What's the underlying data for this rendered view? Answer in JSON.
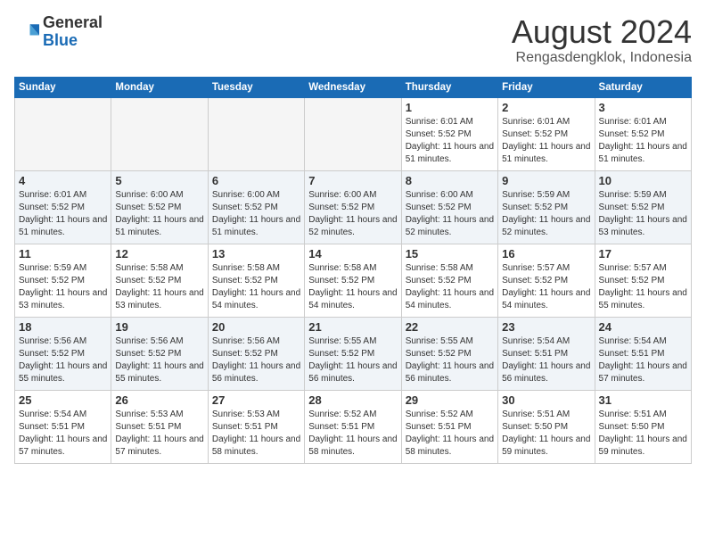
{
  "header": {
    "logo_general": "General",
    "logo_blue": "Blue",
    "month_year": "August 2024",
    "location": "Rengasdengklok, Indonesia"
  },
  "calendar": {
    "days_of_week": [
      "Sunday",
      "Monday",
      "Tuesday",
      "Wednesday",
      "Thursday",
      "Friday",
      "Saturday"
    ],
    "weeks": [
      [
        {
          "day": "",
          "empty": true
        },
        {
          "day": "",
          "empty": true
        },
        {
          "day": "",
          "empty": true
        },
        {
          "day": "",
          "empty": true
        },
        {
          "day": "1",
          "sunrise": "6:01 AM",
          "sunset": "5:52 PM",
          "daylight": "11 hours and 51 minutes."
        },
        {
          "day": "2",
          "sunrise": "6:01 AM",
          "sunset": "5:52 PM",
          "daylight": "11 hours and 51 minutes."
        },
        {
          "day": "3",
          "sunrise": "6:01 AM",
          "sunset": "5:52 PM",
          "daylight": "11 hours and 51 minutes."
        }
      ],
      [
        {
          "day": "4",
          "sunrise": "6:01 AM",
          "sunset": "5:52 PM",
          "daylight": "11 hours and 51 minutes."
        },
        {
          "day": "5",
          "sunrise": "6:00 AM",
          "sunset": "5:52 PM",
          "daylight": "11 hours and 51 minutes."
        },
        {
          "day": "6",
          "sunrise": "6:00 AM",
          "sunset": "5:52 PM",
          "daylight": "11 hours and 51 minutes."
        },
        {
          "day": "7",
          "sunrise": "6:00 AM",
          "sunset": "5:52 PM",
          "daylight": "11 hours and 52 minutes."
        },
        {
          "day": "8",
          "sunrise": "6:00 AM",
          "sunset": "5:52 PM",
          "daylight": "11 hours and 52 minutes."
        },
        {
          "day": "9",
          "sunrise": "5:59 AM",
          "sunset": "5:52 PM",
          "daylight": "11 hours and 52 minutes."
        },
        {
          "day": "10",
          "sunrise": "5:59 AM",
          "sunset": "5:52 PM",
          "daylight": "11 hours and 53 minutes."
        }
      ],
      [
        {
          "day": "11",
          "sunrise": "5:59 AM",
          "sunset": "5:52 PM",
          "daylight": "11 hours and 53 minutes."
        },
        {
          "day": "12",
          "sunrise": "5:58 AM",
          "sunset": "5:52 PM",
          "daylight": "11 hours and 53 minutes."
        },
        {
          "day": "13",
          "sunrise": "5:58 AM",
          "sunset": "5:52 PM",
          "daylight": "11 hours and 54 minutes."
        },
        {
          "day": "14",
          "sunrise": "5:58 AM",
          "sunset": "5:52 PM",
          "daylight": "11 hours and 54 minutes."
        },
        {
          "day": "15",
          "sunrise": "5:58 AM",
          "sunset": "5:52 PM",
          "daylight": "11 hours and 54 minutes."
        },
        {
          "day": "16",
          "sunrise": "5:57 AM",
          "sunset": "5:52 PM",
          "daylight": "11 hours and 54 minutes."
        },
        {
          "day": "17",
          "sunrise": "5:57 AM",
          "sunset": "5:52 PM",
          "daylight": "11 hours and 55 minutes."
        }
      ],
      [
        {
          "day": "18",
          "sunrise": "5:56 AM",
          "sunset": "5:52 PM",
          "daylight": "11 hours and 55 minutes."
        },
        {
          "day": "19",
          "sunrise": "5:56 AM",
          "sunset": "5:52 PM",
          "daylight": "11 hours and 55 minutes."
        },
        {
          "day": "20",
          "sunrise": "5:56 AM",
          "sunset": "5:52 PM",
          "daylight": "11 hours and 56 minutes."
        },
        {
          "day": "21",
          "sunrise": "5:55 AM",
          "sunset": "5:52 PM",
          "daylight": "11 hours and 56 minutes."
        },
        {
          "day": "22",
          "sunrise": "5:55 AM",
          "sunset": "5:52 PM",
          "daylight": "11 hours and 56 minutes."
        },
        {
          "day": "23",
          "sunrise": "5:54 AM",
          "sunset": "5:51 PM",
          "daylight": "11 hours and 56 minutes."
        },
        {
          "day": "24",
          "sunrise": "5:54 AM",
          "sunset": "5:51 PM",
          "daylight": "11 hours and 57 minutes."
        }
      ],
      [
        {
          "day": "25",
          "sunrise": "5:54 AM",
          "sunset": "5:51 PM",
          "daylight": "11 hours and 57 minutes."
        },
        {
          "day": "26",
          "sunrise": "5:53 AM",
          "sunset": "5:51 PM",
          "daylight": "11 hours and 57 minutes."
        },
        {
          "day": "27",
          "sunrise": "5:53 AM",
          "sunset": "5:51 PM",
          "daylight": "11 hours and 58 minutes."
        },
        {
          "day": "28",
          "sunrise": "5:52 AM",
          "sunset": "5:51 PM",
          "daylight": "11 hours and 58 minutes."
        },
        {
          "day": "29",
          "sunrise": "5:52 AM",
          "sunset": "5:51 PM",
          "daylight": "11 hours and 58 minutes."
        },
        {
          "day": "30",
          "sunrise": "5:51 AM",
          "sunset": "5:50 PM",
          "daylight": "11 hours and 59 minutes."
        },
        {
          "day": "31",
          "sunrise": "5:51 AM",
          "sunset": "5:50 PM",
          "daylight": "11 hours and 59 minutes."
        }
      ]
    ]
  },
  "labels": {
    "sunrise_prefix": "Sunrise: ",
    "sunset_prefix": "Sunset: ",
    "daylight_prefix": "Daylight: "
  }
}
